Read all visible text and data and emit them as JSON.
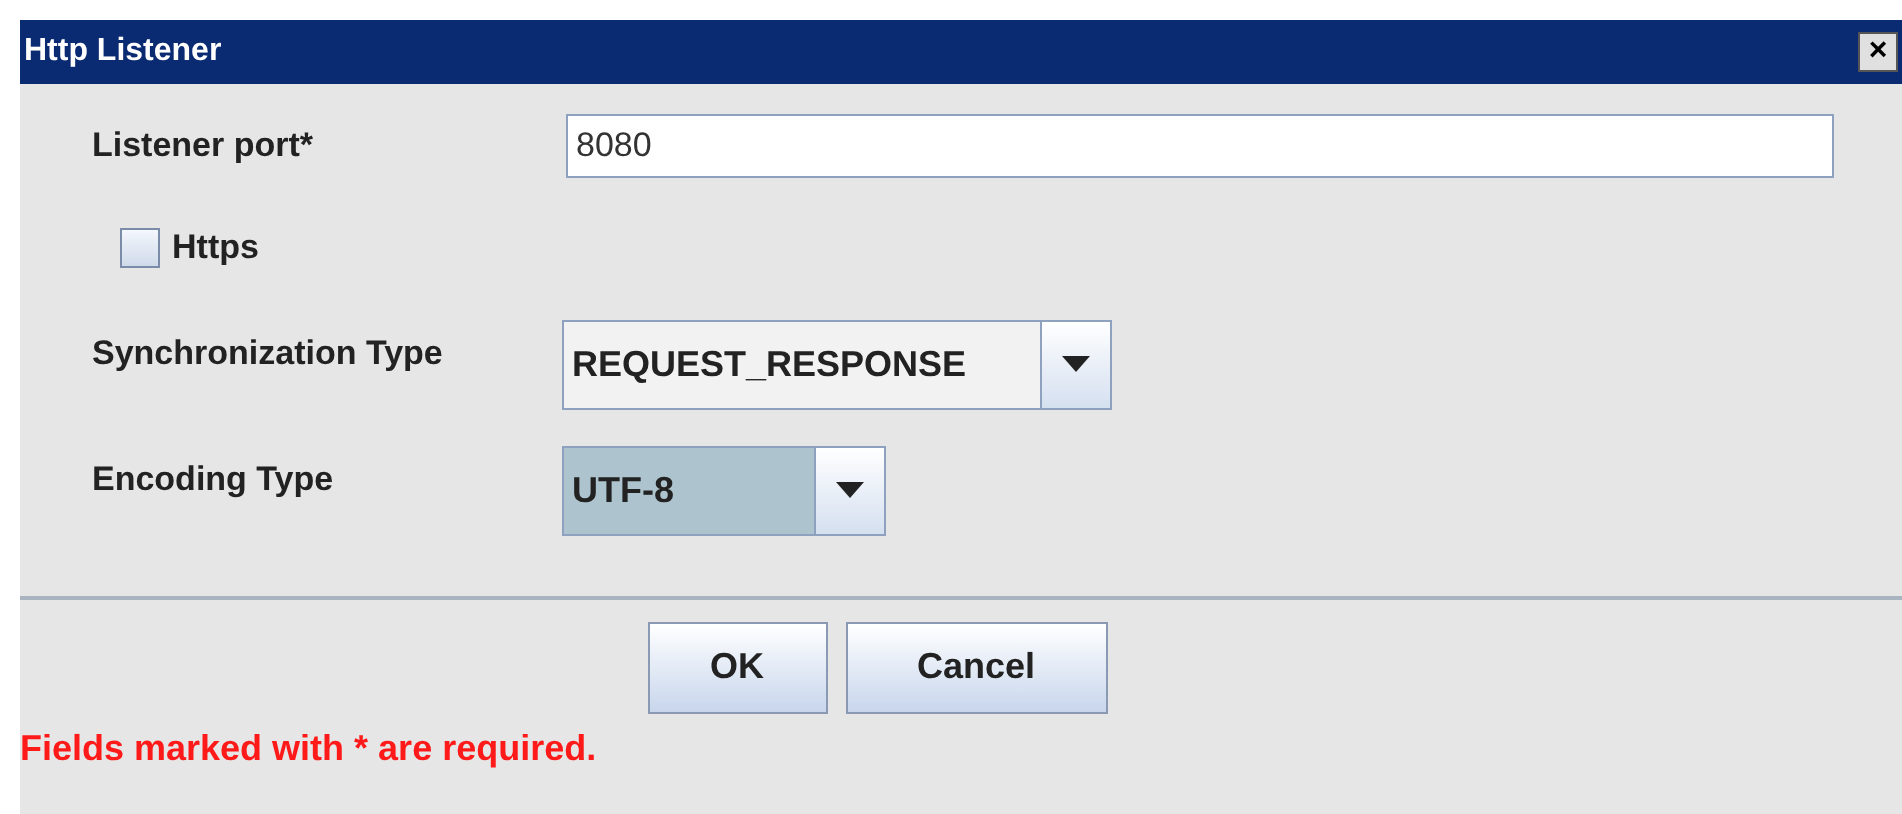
{
  "window": {
    "title": "Http Listener",
    "close": "×"
  },
  "port": {
    "label": "Listener port*",
    "value": "8080"
  },
  "https": {
    "label": "Https",
    "checked": false
  },
  "combos": [
    {
      "label": "Synchronization Type",
      "value": "REQUEST_RESPONSE",
      "focused": false
    },
    {
      "label": "Encoding Type",
      "value": "UTF-8",
      "focused": true
    }
  ],
  "buttons": [
    "OK",
    "Cancel"
  ],
  "footer": "Fields marked with * are required."
}
